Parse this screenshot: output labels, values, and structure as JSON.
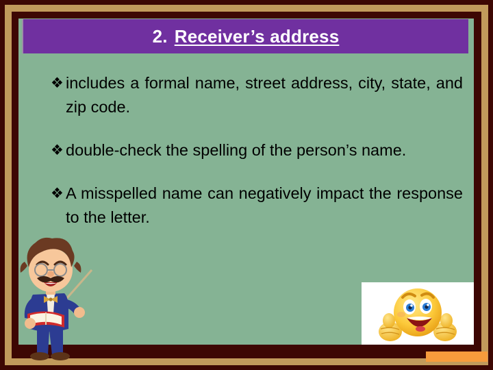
{
  "slide": {
    "title": {
      "number": "2.",
      "text": "Receiver’s address"
    },
    "bullets": [
      {
        "marker": "❖",
        "text": "includes a formal name, street address, city, state, and zip code."
      },
      {
        "marker": "❖",
        "text": "double-check the spelling of the person’s name."
      },
      {
        "marker": "❖",
        "text": "A misspelled name can negatively impact the response to the letter."
      }
    ],
    "images": [
      {
        "name": "professor-teacher-illustration",
        "alt": "Cartoon professor with glasses, mustache, blue suit holding a red book and a pointer"
      },
      {
        "name": "smiley-thumbs-up-image",
        "alt": "Yellow smiley face giving two thumbs up"
      }
    ],
    "colors": {
      "border_outer": "#3D0703",
      "border_frame": "#C29A5B",
      "board": "#85B394",
      "title_band": "#7030A0",
      "title_text": "#FFFFFF",
      "body_text": "#000000",
      "accent_bar": "#F79B3C"
    }
  }
}
